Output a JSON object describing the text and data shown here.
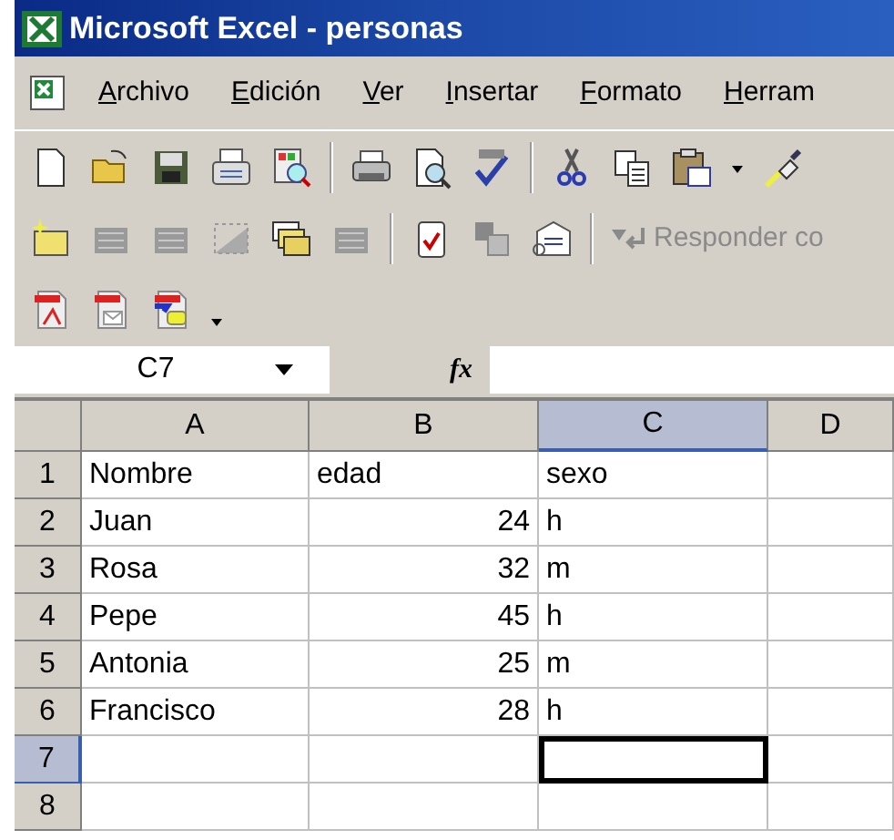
{
  "window": {
    "title": "Microsoft Excel - personas"
  },
  "menu": [
    {
      "label": "Archivo"
    },
    {
      "label": "Edición"
    },
    {
      "label": "Ver"
    },
    {
      "label": "Insertar"
    },
    {
      "label": "Formato"
    },
    {
      "label": "Herram"
    }
  ],
  "reviewing_toolbar": {
    "reply_button": {
      "label": "Responder co",
      "disabled": true
    }
  },
  "formula_bar": {
    "name_box": "C7",
    "function_label": "fx"
  },
  "sheet": {
    "columns": [
      {
        "label": "A",
        "selected": false
      },
      {
        "label": "B",
        "selected": false
      },
      {
        "label": "C",
        "selected": true
      },
      {
        "label": "D",
        "selected": false
      }
    ],
    "rows": [
      {
        "label": "1",
        "selected": false,
        "cells": [
          {
            "value": "Nombre",
            "kind": "text",
            "selected": false
          },
          {
            "value": "edad",
            "kind": "text",
            "selected": false
          },
          {
            "value": "sexo",
            "kind": "text",
            "selected": false
          },
          {
            "selected": false
          }
        ]
      },
      {
        "label": "2",
        "selected": false,
        "cells": [
          {
            "value": "Juan",
            "kind": "text",
            "selected": false
          },
          {
            "value": "24",
            "kind": "number",
            "selected": false
          },
          {
            "value": "h",
            "kind": "text",
            "selected": false
          },
          {
            "selected": false
          }
        ]
      },
      {
        "label": "3",
        "selected": false,
        "cells": [
          {
            "value": "Rosa",
            "kind": "text",
            "selected": false
          },
          {
            "value": "32",
            "kind": "number",
            "selected": false
          },
          {
            "value": "m",
            "kind": "text",
            "selected": false
          },
          {
            "selected": false
          }
        ]
      },
      {
        "label": "4",
        "selected": false,
        "cells": [
          {
            "value": "Pepe",
            "kind": "text",
            "selected": false
          },
          {
            "value": "45",
            "kind": "number",
            "selected": false
          },
          {
            "value": "h",
            "kind": "text",
            "selected": false
          },
          {
            "selected": false
          }
        ]
      },
      {
        "label": "5",
        "selected": false,
        "cells": [
          {
            "value": "Antonia",
            "kind": "text",
            "selected": false
          },
          {
            "value": "25",
            "kind": "number",
            "selected": false
          },
          {
            "value": "m",
            "kind": "text",
            "selected": false
          },
          {
            "selected": false
          }
        ]
      },
      {
        "label": "6",
        "selected": false,
        "cells": [
          {
            "value": "Francisco",
            "kind": "text",
            "selected": false
          },
          {
            "value": "28",
            "kind": "number",
            "selected": false
          },
          {
            "value": "h",
            "kind": "text",
            "selected": false
          },
          {
            "selected": false
          }
        ]
      },
      {
        "label": "7",
        "selected": true,
        "cells": [
          {
            "selected": false
          },
          {
            "selected": false
          },
          {
            "selected": true
          },
          {
            "selected": false
          }
        ]
      },
      {
        "label": "8",
        "selected": false,
        "cells": [
          {
            "selected": false
          },
          {
            "selected": false
          },
          {
            "selected": false
          },
          {
            "selected": false
          }
        ]
      }
    ]
  }
}
